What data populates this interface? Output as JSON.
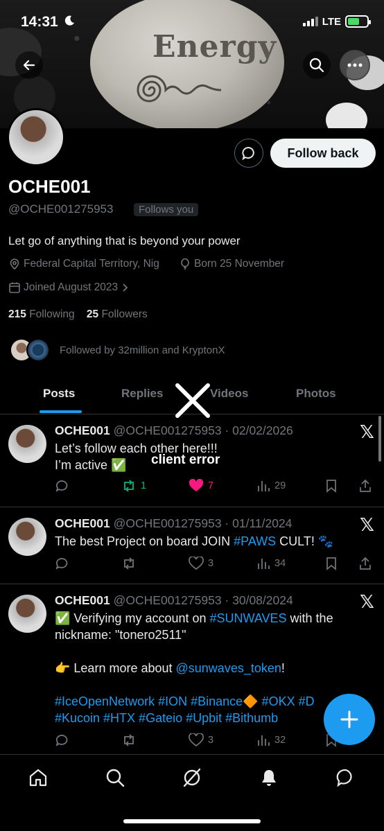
{
  "status_bar": {
    "time": "14:31",
    "network": "LTE"
  },
  "banner": {
    "stone_text": "Energy"
  },
  "profile": {
    "name": "OCHE001",
    "handle": "@OCHE001275953",
    "follows_you": "Follows you",
    "bio": "Let go of anything that is beyond your power",
    "location": "Federal Capital Territory, Nig",
    "birthday": "Born 25 November",
    "joined": "Joined August 2023",
    "following_count": "215",
    "following_label": "Following",
    "followers_count": "25",
    "followers_label": "Followers",
    "followed_by": "Followed by 32million and KryptonX"
  },
  "buttons": {
    "follow_back": "Follow back"
  },
  "tabs": [
    {
      "label": "Posts",
      "active": true
    },
    {
      "label": "Replies"
    },
    {
      "label": "Videos"
    },
    {
      "label": "Photos"
    }
  ],
  "overlay": {
    "error_text": "client error"
  },
  "posts": [
    {
      "name": "OCHE001",
      "meta": "@OCHE001275953 · 02/02/2026",
      "text_lines": [
        "Let’s follow each other here!!!",
        "I’m active ✅"
      ],
      "replies": "",
      "reposts": "1",
      "likes": "7",
      "views": "29"
    },
    {
      "name": "OCHE001",
      "meta": "@OCHE001275953 · 01/11/2024",
      "text_before": "The best Project on board JOIN ",
      "hashtag": "#PAWS",
      "text_after": " CULT! 🐾",
      "replies": "",
      "reposts": "",
      "likes": "3",
      "views": "34"
    },
    {
      "name": "OCHE001",
      "meta": "@OCHE001275953 · 30/08/2024",
      "line1_before": "✅ Verifying my account on ",
      "line1_tag": "#SUNWAVES",
      "line1_after": " with the",
      "line2": "nickname: \"tonero2511\"",
      "line3_before": "👉 Learn more about ",
      "line3_mention": "@sunwaves_token",
      "line3_after": "!",
      "line4": "#IceOpenNetwork #ION #Binance🔶 #OKX #D",
      "line5": "#Kucoin #HTX #Gateio #Upbit #Bithumb",
      "replies": "",
      "reposts": "",
      "likes": "3",
      "views": "32"
    }
  ],
  "colors": {
    "accent": "#1d9bf0",
    "like_active": "#f91880",
    "repost_active": "#00ba7c",
    "background": "#000000"
  },
  "nav": [
    "home-icon",
    "search-icon",
    "grok-icon",
    "notifications-icon",
    "messages-icon"
  ]
}
